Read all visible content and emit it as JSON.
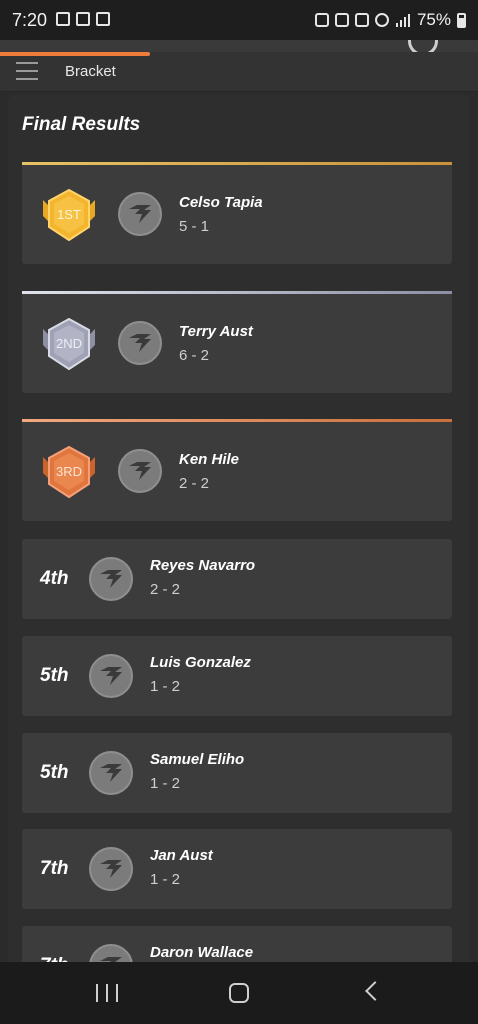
{
  "status_bar": {
    "time": "7:20",
    "battery": "75%",
    "left_icons": [
      "image-icon",
      "share-icon",
      "share-icon"
    ],
    "right_icons": [
      "battery-saver-icon",
      "mute-icon",
      "wifi-icon",
      "dnd-icon",
      "signal-icon",
      "battery-icon"
    ]
  },
  "subnav": {
    "title": "Bracket"
  },
  "results": {
    "title": "Final Results",
    "podium": [
      {
        "rank": "1ST",
        "name": "Celso Tapia",
        "record": "5 - 1",
        "medal_color": "#f3b42e"
      },
      {
        "rank": "2ND",
        "name": "Terry Aust",
        "record": "6 - 2",
        "medal_color": "#9fa1b4"
      },
      {
        "rank": "3RD",
        "name": "Ken Hile",
        "record": "2 - 2",
        "medal_color": "#e0763d"
      }
    ],
    "others": [
      {
        "rank": "4th",
        "name": "Reyes Navarro",
        "record": "2 - 2"
      },
      {
        "rank": "5th",
        "name": "Luis Gonzalez",
        "record": "1 - 2"
      },
      {
        "rank": "5th",
        "name": "Samuel Eliho",
        "record": "1 - 2"
      },
      {
        "rank": "7th",
        "name": "Jan Aust",
        "record": "1 - 2"
      },
      {
        "rank": "7th",
        "name": "Daron Wallace",
        "record": ""
      }
    ]
  },
  "colors": {
    "accent_orange": "#f07c3c",
    "gold": "#e7c266",
    "silver": "#c9cbd8",
    "bronze": "#e08a5c"
  }
}
